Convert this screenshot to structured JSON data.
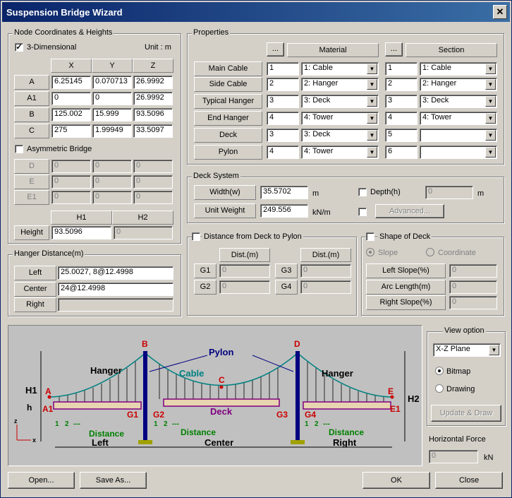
{
  "window": {
    "title": "Suspension Bridge Wizard",
    "close_glyph": "✕"
  },
  "node": {
    "legend": "Node Coordinates & Heights",
    "three_d_label": "3-Dimensional",
    "three_d_checked": true,
    "unit_label": "Unit  : m",
    "cols": [
      "X",
      "Y",
      "Z"
    ],
    "rows": [
      {
        "name": "A",
        "x": "6.25145",
        "y": "0.070713",
        "z": "26.9992"
      },
      {
        "name": "A1",
        "x": "0",
        "y": "0",
        "z": "26.9992"
      },
      {
        "name": "B",
        "x": "125.002",
        "y": "15.999",
        "z": "93.5096"
      },
      {
        "name": "C",
        "x": "275",
        "y": "1.99949",
        "z": "33.5097"
      }
    ],
    "asym_label": "Asymmetric Bridge",
    "asym_checked": false,
    "asym_rows": [
      {
        "name": "D",
        "x": "0",
        "y": "0",
        "z": "0"
      },
      {
        "name": "E",
        "x": "0",
        "y": "0",
        "z": "0"
      },
      {
        "name": "E1",
        "x": "0",
        "y": "0",
        "z": "0"
      }
    ],
    "h1_label": "H1",
    "h2_label": "H2",
    "height_label": "Height",
    "h1_value": "93.5096",
    "h2_value": "0"
  },
  "hanger": {
    "legend": "Hanger Distance(m)",
    "left_label": "Left",
    "left_value": "25.0027, 8@12.4998",
    "center_label": "Center",
    "center_value": "24@12.4998",
    "right_label": "Right",
    "right_value": ""
  },
  "properties": {
    "legend": "Properties",
    "dots": "...",
    "material_label": "Material",
    "section_label": "Section",
    "rows": [
      {
        "label": "Main Cable",
        "mat_no": "1",
        "mat": "1: Cable",
        "sec_no": "1",
        "sec": "1: Cable"
      },
      {
        "label": "Side Cable",
        "mat_no": "2",
        "mat": "2: Hanger",
        "sec_no": "2",
        "sec": "2: Hanger"
      },
      {
        "label": "Typical Hanger",
        "mat_no": "3",
        "mat": "3: Deck",
        "sec_no": "3",
        "sec": "3: Deck"
      },
      {
        "label": "End Hanger",
        "mat_no": "4",
        "mat": "4: Tower",
        "sec_no": "4",
        "sec": "4: Tower"
      },
      {
        "label": "Deck",
        "mat_no": "3",
        "mat": "3: Deck",
        "sec_no": "5",
        "sec": ""
      },
      {
        "label": "Pylon",
        "mat_no": "4",
        "mat": "4: Tower",
        "sec_no": "6",
        "sec": ""
      }
    ]
  },
  "deck_system": {
    "legend": "Deck System",
    "width_label": "Width(w)",
    "width_value": "35.5702",
    "width_unit": "m",
    "weight_label": "Unit Weight",
    "weight_value": "249.556",
    "weight_unit": "kN/m",
    "depth_label": "Depth(h)",
    "depth_value": "0",
    "depth_unit": "m",
    "advanced_label": "Advanced..."
  },
  "distance": {
    "legend": "Distance from Deck to Pylon",
    "col_label": "Dist.(m)",
    "g1": "G1",
    "g2": "G2",
    "g3": "G3",
    "g4": "G4",
    "g1_value": "0",
    "g2_value": "0",
    "g3_value": "0",
    "g4_value": "0"
  },
  "shape": {
    "legend": "Shape of Deck",
    "slope_label": "Slope",
    "coord_label": "Coordinate",
    "left_slope_label": "Left Slope(%)",
    "arc_label": "Arc Length(m)",
    "right_slope_label": "Right Slope(%)",
    "left_slope_value": "0",
    "arc_value": "0",
    "right_slope_value": "0"
  },
  "view": {
    "legend": "View option",
    "plane": "X-Z Plane",
    "bitmap_label": "Bitmap",
    "drawing_label": "Drawing",
    "update_label": "Update & Draw",
    "hforce_label": "Horizontal Force",
    "hforce_value": "0",
    "hforce_unit": "kN"
  },
  "diagram": {
    "B": "B",
    "D": "D",
    "C": "C",
    "A": "A",
    "A1": "A1",
    "E": "E",
    "E1": "E1",
    "pylon": "Pylon",
    "hanger": "Hanger",
    "cable": "Cable",
    "deck": "Deck",
    "H1": "H1",
    "H2": "H2",
    "h": "h",
    "G1": "G1",
    "G2": "G2",
    "G3": "G3",
    "G4": "G4",
    "distance": "Distance",
    "left": "Left",
    "center": "Center",
    "right": "Right",
    "n1": "1",
    "n2": "2",
    "ndots": "---",
    "z_axis": "z",
    "x_axis": "x",
    "colors": {
      "pylon": "#000080",
      "cable": "#008080",
      "deck": "#800080",
      "hanger_text": "#000000",
      "point": "#cc0000",
      "distance": "#008000"
    }
  },
  "buttons": {
    "open": "Open...",
    "save": "Save As...",
    "ok": "OK",
    "close": "Close"
  }
}
